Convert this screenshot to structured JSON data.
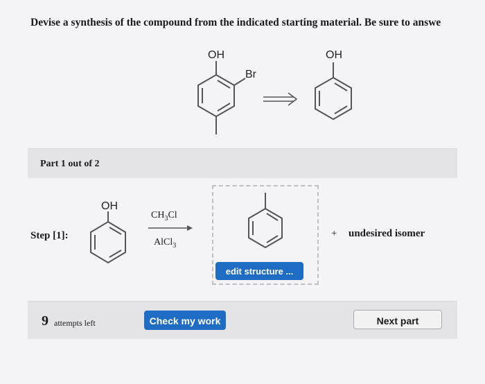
{
  "question": {
    "text": "Devise a synthesis of the compound from the indicated starting material. Be sure to answe"
  },
  "reaction": {
    "start_oh": "OH",
    "start_br": "Br",
    "product_oh": "OH"
  },
  "part": {
    "label": "Part 1 out of 2"
  },
  "step": {
    "label": "Step [1]:",
    "reactant_oh": "OH",
    "reagent_top": "CH",
    "reagent_top_sub": "3",
    "reagent_top_tail": "Cl",
    "reagent_bottom": "AlCl",
    "reagent_bottom_sub": "3",
    "edit_label": "edit structure ...",
    "plus": "+",
    "isomer": "undesired isomer"
  },
  "footer": {
    "attempts_count": "9",
    "attempts_text": "attempts left",
    "check_label": "Check my work",
    "next_label": "Next part"
  },
  "colors": {
    "button_blue": "#1f6cc4",
    "panel_gray": "#e4e4e6"
  }
}
